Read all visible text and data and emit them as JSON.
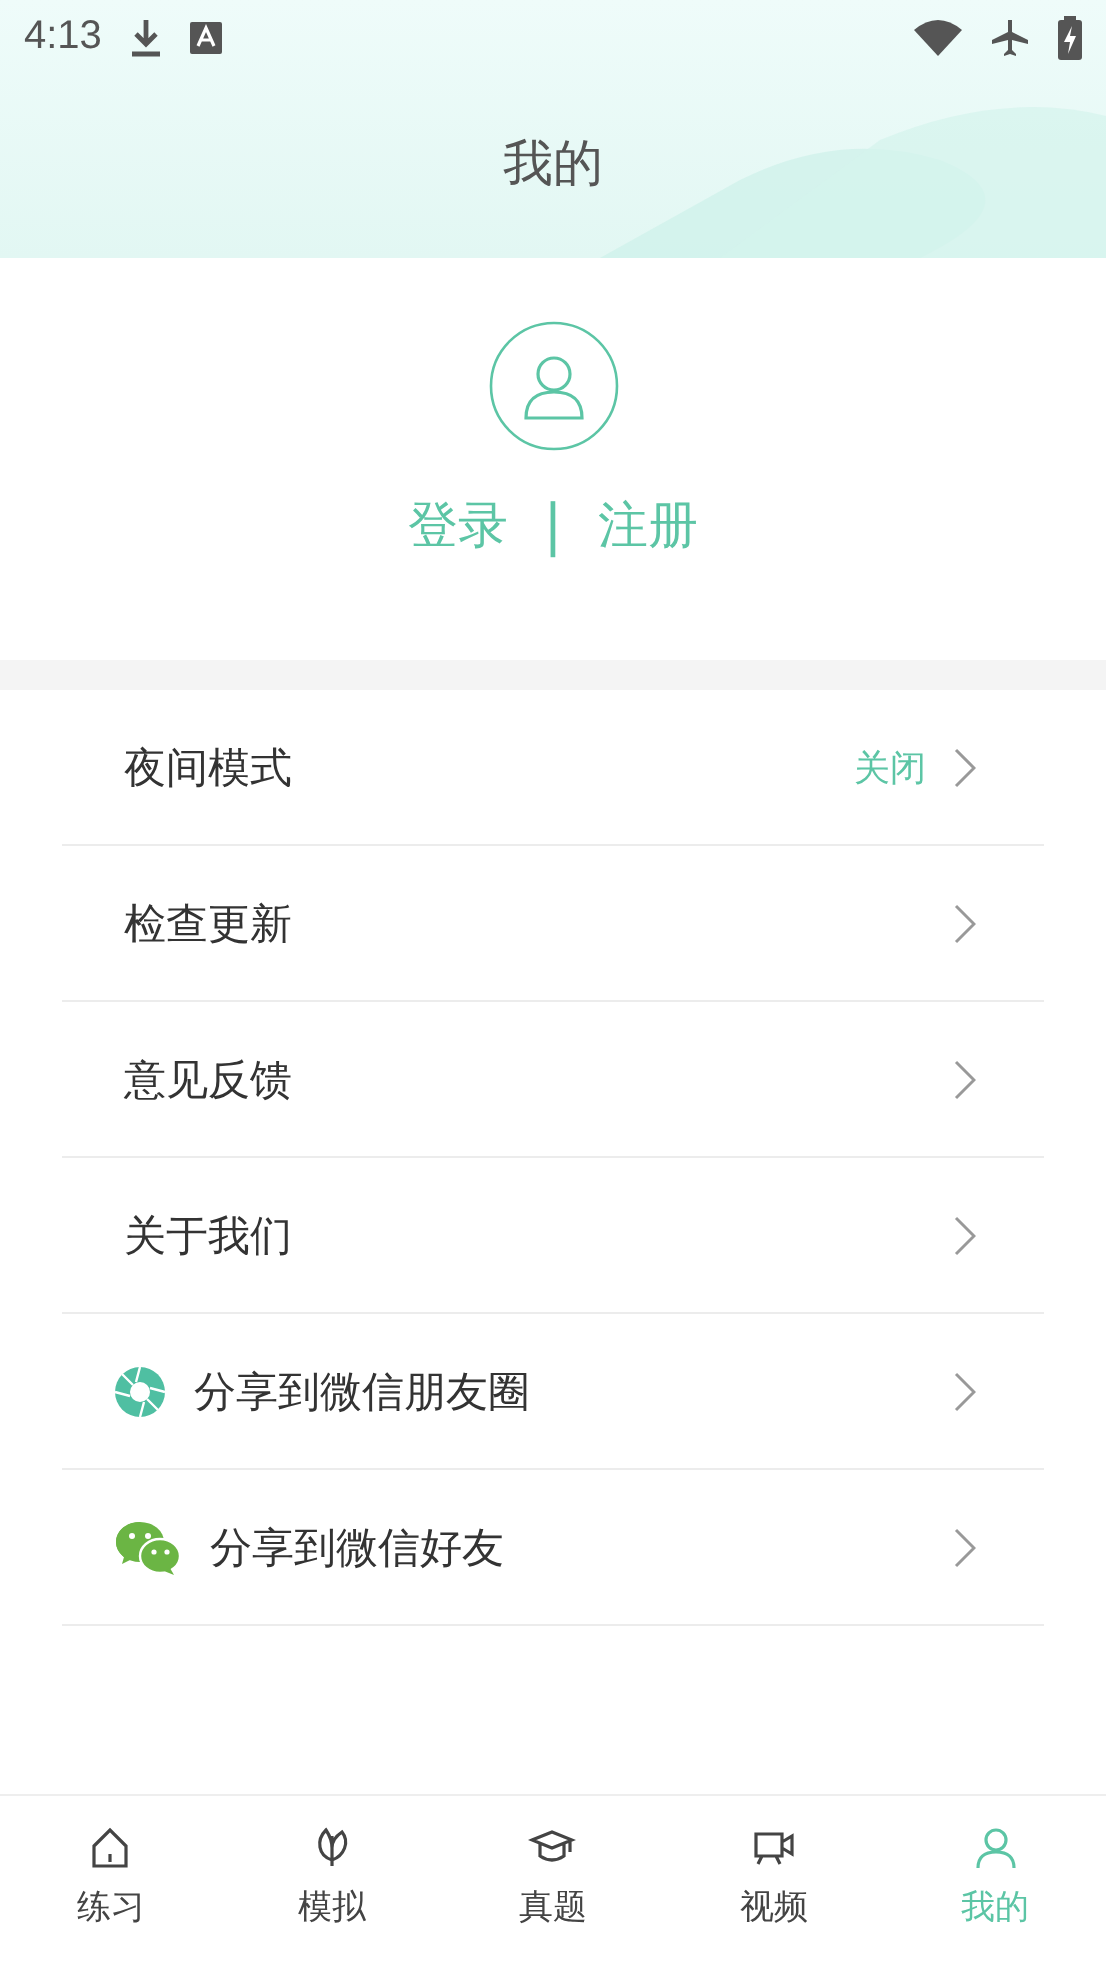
{
  "status_bar": {
    "time": "4:13"
  },
  "header": {
    "title": "我的"
  },
  "account": {
    "login": "登录",
    "divider": "|",
    "register": "注册"
  },
  "settings": [
    {
      "kind": "plain",
      "label": "夜间模式",
      "value": "关闭"
    },
    {
      "kind": "plain",
      "label": "检查更新"
    },
    {
      "kind": "plain",
      "label": "意见反馈"
    },
    {
      "kind": "plain",
      "label": "关于我们"
    },
    {
      "kind": "moments",
      "label": "分享到微信朋友圈"
    },
    {
      "kind": "wechat",
      "label": "分享到微信好友"
    }
  ],
  "tab_bar": [
    {
      "kind": "home",
      "label": "练习",
      "selected": false
    },
    {
      "kind": "leaf",
      "label": "模拟",
      "selected": false
    },
    {
      "kind": "cap",
      "label": "真题",
      "selected": false
    },
    {
      "kind": "video",
      "label": "视频",
      "selected": false
    },
    {
      "kind": "person",
      "label": "我的",
      "selected": true
    }
  ]
}
